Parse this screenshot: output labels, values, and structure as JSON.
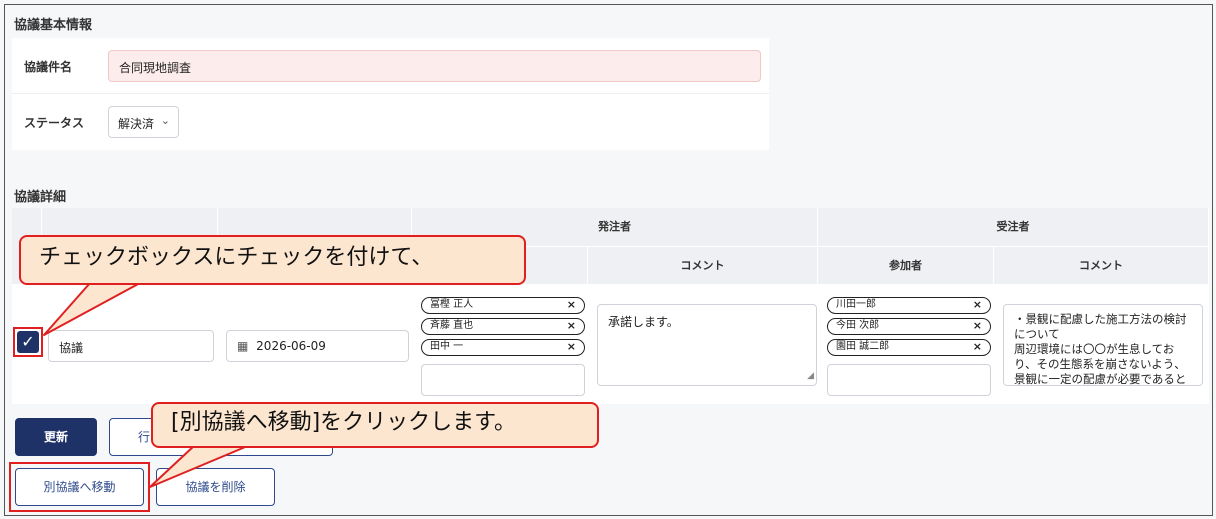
{
  "basic_info": {
    "section_title": "協議基本情報",
    "name_label": "協議件名",
    "name_value": "合同現地調査",
    "status_label": "ステータス",
    "status_value": "解決済"
  },
  "detail": {
    "section_title": "協議詳細",
    "header_client": "発注者",
    "header_contractor": "受注者",
    "sub_comment_client": "コメント",
    "sub_participants": "参加者",
    "sub_comment_contractor": "コメント",
    "row": {
      "checked": true,
      "type_value": "協議",
      "date_value": "2026-06-09",
      "client_participants": [
        "冨樫 正人",
        "斉藤 直也",
        "田中 一"
      ],
      "client_comment": "承諾します。",
      "contractor_participants": [
        "川田一郎",
        "今田 次郎",
        "園田 誠二郎"
      ],
      "contractor_comment": "・景観に配慮した施工方法の検討について\n周辺環境には〇〇が生息しており、その生態系を崩さないよう、景観に一定の配慮が必要であると判断しま"
    }
  },
  "buttons": {
    "update": "更新",
    "add_row_partial": "行",
    "move_to_other": "別協議へ移動",
    "delete": "協議を削除"
  },
  "callouts": {
    "check": "チェックボックスにチェックを付けて、",
    "click": "[別協議へ移動]をクリックします。"
  },
  "icons": {
    "calendar": "calendar-icon",
    "chevron": "chevron-down-icon",
    "close": "close-icon"
  },
  "colors": {
    "primary": "#1e3268",
    "callout_fill": "#fde6cf",
    "highlight": "#e02020",
    "required_bg": "#fdecec"
  }
}
